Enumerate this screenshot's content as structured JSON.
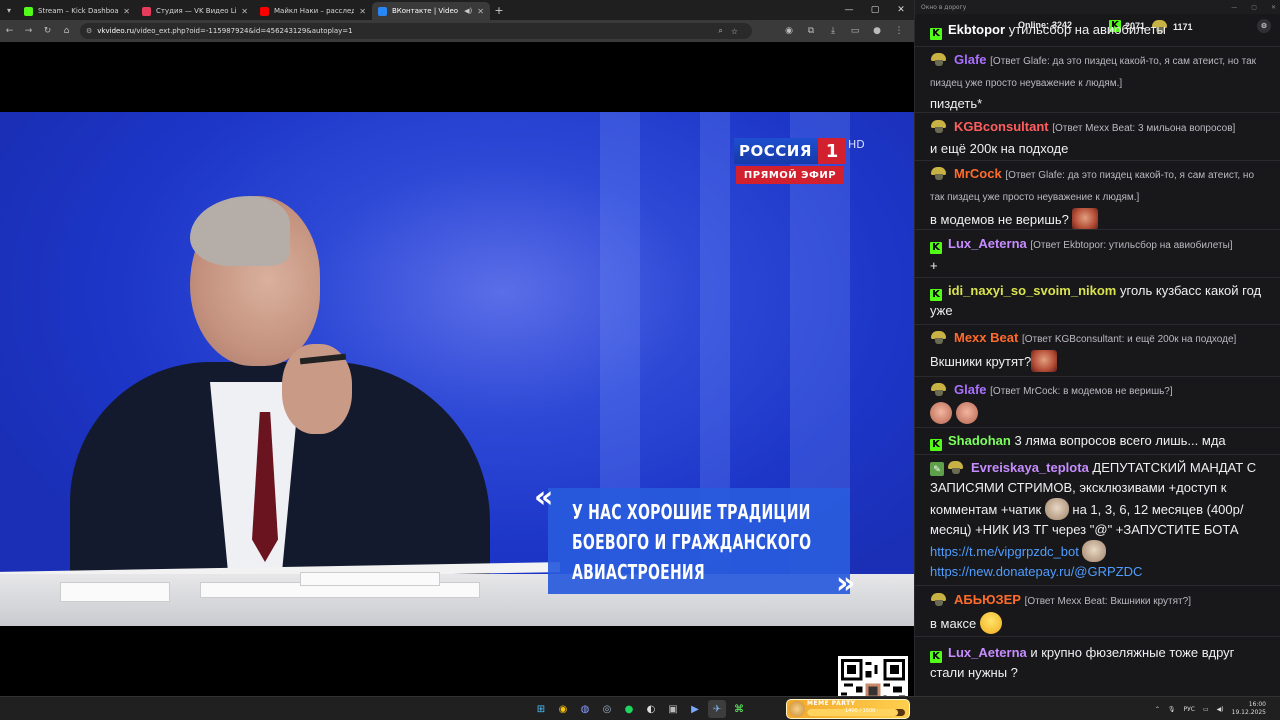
{
  "browser": {
    "tabs": [
      {
        "title": "Stream – Kick Dashboard",
        "fav_color": "#53fc18",
        "active": false
      },
      {
        "title": "Студия — VK Видео Live",
        "fav_color": "#e63b5a",
        "active": false
      },
      {
        "title": "Майкл Наки – расслед...",
        "fav_color": "#ff0000",
        "active": false
      },
      {
        "title": "ВКонтакте | Video Ext",
        "fav_color": "#2787f5",
        "active": true
      }
    ],
    "url_domain": "vkvideo.ru",
    "url_rest": "/video_ext.php?oid=-115987924&id=456243129&autoplay=1"
  },
  "video": {
    "channel_logo_text": "РОССИЯ",
    "channel_logo_number": "1",
    "channel_logo_hd": "HD",
    "live_label": "ПРЯМОЙ ЭФИР",
    "caption_lines": [
      "У НАС ХОРОШИЕ ТРАДИЦИИ",
      "БОЕВОГО И ГРАЖДАНСКОГО",
      "АВИАСТРОЕНИЯ"
    ],
    "quote_open": "«",
    "quote_close": "»"
  },
  "chat": {
    "window_title": "Окно в дорогу",
    "online_label": "Online:",
    "online_count": "3242",
    "kick_count": "2071",
    "helmet_count": "1171",
    "messages": [
      {
        "user": "Ekbtopor",
        "color": "#ffffff",
        "badge": "helmet",
        "reply": "",
        "text": "утильсбор на авиобилеты",
        "top": 0
      },
      {
        "user": "Glafe",
        "color": "#a970ff",
        "badge": "helmet",
        "reply": "[Ответ Glafe: да это пиздец какой-то, я сам атеист, но так пиздец уже просто неуважение к людям.]",
        "text": "пиздеть*"
      },
      {
        "user": "KGBconsultant",
        "color": "#ff5e5e",
        "badge": "helmet",
        "reply": "[Ответ Mexx Beat: 3 мильона вопросов]",
        "text": "и ещё 200к на подходе"
      },
      {
        "user": "MrCock",
        "color": "#ff6b2b",
        "badge": "helmet",
        "reply": "[Ответ Glafe: да это пиздец какой-то, я сам атеист, но так пиздец уже просто неуважение к людям.]",
        "text": "в модемов не веришь?"
      },
      {
        "user": "Lux_Aeterna",
        "color": "#c78cff",
        "badge": "kick",
        "reply": "[Ответ Ekbtopor: утильсбор на авиобилеты]",
        "text": "+"
      },
      {
        "user": "idi_naxyi_so_svoim_nikom",
        "color": "#d9e24f",
        "badge": "kick",
        "reply": "",
        "text": "уголь кузбасс какой год уже"
      },
      {
        "user": "Mexx Beat",
        "color": "#ff6b2b",
        "badge": "helmet",
        "reply": "[Ответ KGBconsultant: и ещё 200к на подходе]",
        "text": "Вкшники крутят?"
      },
      {
        "user": "Glafe",
        "color": "#a970ff",
        "badge": "helmet",
        "reply": "[Ответ MrCock: в модемов не веришь?]",
        "text": ""
      },
      {
        "user": "Shadohan",
        "color": "#7cff5e",
        "badge": "kick",
        "reply": "",
        "text": "3 ляма вопросов всего лишь... мда"
      },
      {
        "user": "Evreiskaya_teplota",
        "color": "#c78cff",
        "badge": "pen-helmet",
        "reply": "",
        "text": "ДЕПУТАТСКИЙ МАНДАТ С ЗАПИСЯМИ СТРИМОВ, эксклюзивами +доступ к комментам +чатик",
        "text2": "на 1, 3, 6, 12 месяцев (400р/месяц) +НИК ИЗ ТГ через \"@\" +ЗАПУСТИТЕ БОТА",
        "link1": "https://t.me/vipgrpzdc_bot",
        "link2": "https://new.donatepay.ru/@GRPZDC"
      },
      {
        "user": "АБЬЮЗЕР",
        "color": "#ff6b2b",
        "badge": "helmet",
        "reply": "[Ответ Mexx Beat: Вкшники крутят?]",
        "text": "в максе"
      },
      {
        "user": "Lux_Aeterna",
        "color": "#c78cff",
        "badge": "kick",
        "reply": "",
        "text": "и крупно фюзеляжные тоже вдруг стали нужны ?"
      }
    ]
  },
  "taskbar": {
    "meme_title": "MEME PARTY",
    "meme_count": "1400 / 1500",
    "meme_progress": 0.93,
    "lang": "РУС",
    "time": "16:00",
    "date": "19.12.2025"
  }
}
